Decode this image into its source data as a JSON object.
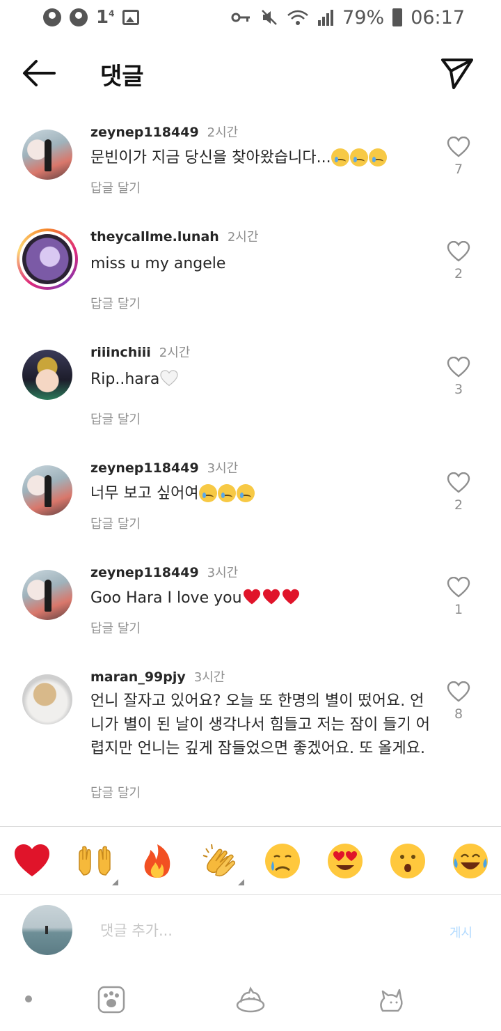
{
  "status_bar": {
    "notif_count": "1",
    "notif_sup": "4",
    "battery": "79%",
    "time": "06:17"
  },
  "header": {
    "title": "댓글"
  },
  "comments": [
    {
      "username": "zeynep118449",
      "time": "2시간",
      "text": "문빈이가 지금 당신을 찾아왔습니다...",
      "emoji": "crying-face x3",
      "reply": "답글 달기",
      "likes": "7"
    },
    {
      "username": "theycallme.lunah",
      "time": "2시간",
      "text": "miss u my angele",
      "reply": "답글 달기",
      "likes": "2"
    },
    {
      "username": "riiinchiii",
      "time": "2시간",
      "text": "Rip..hara",
      "emoji": "white-heart",
      "reply": "답글 달기",
      "likes": "3"
    },
    {
      "username": "zeynep118449",
      "time": "3시간",
      "text": "너무 보고 싶어여",
      "emoji": "crying-face x3",
      "reply": "답글 달기",
      "likes": "2"
    },
    {
      "username": "zeynep118449",
      "time": "3시간",
      "text": "Goo Hara I love you",
      "emoji": "red-heart x3",
      "reply": "답글 달기",
      "likes": "1"
    },
    {
      "username": "maran_99pjy",
      "time": "3시간",
      "text": "언니 잘자고 있어요? 오늘 또 한명의 별이 떴어요. 언니가 별이 된 날이 생각나서 힘들고 저는 잠이 들기 어렵지만 언니는 깊게 잠들었으면 좋겠어요. 또 올게요.",
      "reply": "답글 달기",
      "likes": "8"
    }
  ],
  "reactions": [
    "red-heart",
    "raising-hands",
    "fire",
    "clapping-hands",
    "crying-face",
    "heart-eyes-face",
    "surprised-face",
    "tears-of-joy-face"
  ],
  "input": {
    "placeholder": "댓글 추가...",
    "post_label": "게시"
  },
  "colors": {
    "text": "#262626",
    "muted": "#8e8e8e",
    "post_disabled": "#b3dbff"
  }
}
